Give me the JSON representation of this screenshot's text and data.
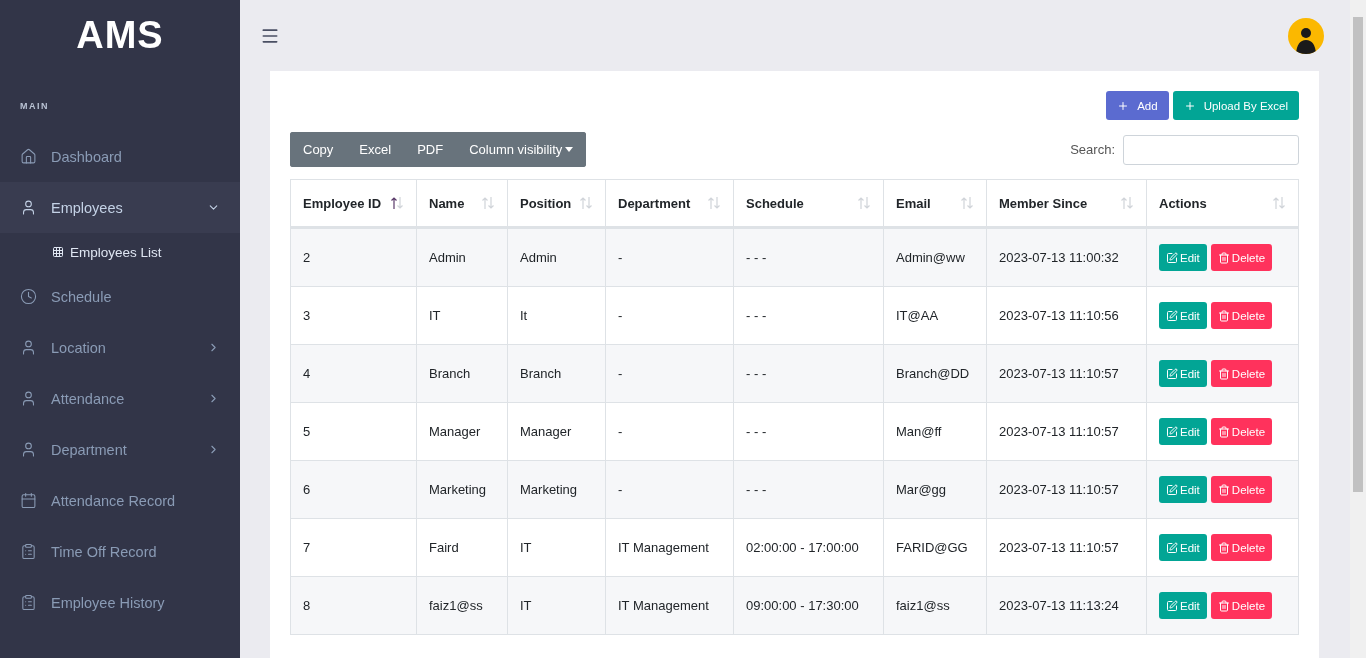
{
  "brand": "AMS",
  "sidebar": {
    "section": "MAIN",
    "items": [
      {
        "label": "Dashboard",
        "kind": "link",
        "selected": false
      },
      {
        "label": "Employees",
        "kind": "group",
        "selected": true,
        "expanded": true,
        "children": [
          {
            "label": "Employees List"
          }
        ]
      },
      {
        "label": "Schedule",
        "kind": "link",
        "selected": false
      },
      {
        "label": "Location",
        "kind": "group",
        "selected": false,
        "expanded": false
      },
      {
        "label": "Attendance",
        "kind": "group",
        "selected": false,
        "expanded": false
      },
      {
        "label": "Department",
        "kind": "group",
        "selected": false,
        "expanded": false
      },
      {
        "label": "Attendance Record",
        "kind": "link",
        "selected": false
      },
      {
        "label": "Time Off Record",
        "kind": "link",
        "selected": false
      },
      {
        "label": "Employee History",
        "kind": "link",
        "selected": false
      }
    ]
  },
  "page_actions": [
    {
      "label": "Add",
      "kind": "primary"
    },
    {
      "label": "Upload By Excel",
      "kind": "success"
    }
  ],
  "export_buttons": [
    {
      "label": "Copy",
      "kind": "plain"
    },
    {
      "label": "Excel",
      "kind": "plain"
    },
    {
      "label": "PDF",
      "kind": "plain"
    },
    {
      "label": "Column visibility",
      "kind": "dropdown"
    }
  ],
  "search": {
    "label": "Search:"
  },
  "table": {
    "columns": [
      {
        "label": "Employee ID",
        "sorted_ascending": true
      },
      {
        "label": "Name",
        "sorted_ascending": false
      },
      {
        "label": "Position",
        "sorted_ascending": false
      },
      {
        "label": "Department",
        "sorted_ascending": false
      },
      {
        "label": "Schedule",
        "sorted_ascending": false
      },
      {
        "label": "Email",
        "sorted_ascending": false
      },
      {
        "label": "Member Since",
        "sorted_ascending": false
      },
      {
        "label": "Actions",
        "sorted_ascending": false
      }
    ],
    "rows": [
      {
        "cells": [
          "2",
          "Admin",
          "Admin",
          "-",
          "- - -",
          "Admin@ww",
          "2023-07-13 11:00:32"
        ],
        "actions": [
          "Edit",
          "Delete"
        ]
      },
      {
        "cells": [
          "3",
          "IT",
          "It",
          "-",
          "- - -",
          "IT@AA",
          "2023-07-13 11:10:56"
        ],
        "actions": [
          "Edit",
          "Delete"
        ]
      },
      {
        "cells": [
          "4",
          "Branch",
          "Branch",
          "-",
          "- - -",
          "Branch@DD",
          "2023-07-13 11:10:57"
        ],
        "actions": [
          "Edit",
          "Delete"
        ]
      },
      {
        "cells": [
          "5",
          "Manager",
          "Manager",
          "-",
          "- - -",
          "Man@ff",
          "2023-07-13 11:10:57"
        ],
        "actions": [
          "Edit",
          "Delete"
        ]
      },
      {
        "cells": [
          "6",
          "Marketing",
          "Marketing",
          "-",
          "- - -",
          "Mar@gg",
          "2023-07-13 11:10:57"
        ],
        "actions": [
          "Edit",
          "Delete"
        ]
      },
      {
        "cells": [
          "7",
          "Faird",
          "IT",
          "IT Management",
          "02:00:00 - 17:00:00",
          "FARID@GG",
          "2023-07-13 11:10:57"
        ],
        "actions": [
          "Edit",
          "Delete"
        ]
      },
      {
        "cells": [
          "8",
          "faiz1@ss",
          "IT",
          "IT Management",
          "09:00:00 - 17:30:00",
          "faiz1@ss",
          "2023-07-13 11:13:24"
        ],
        "actions": [
          "Edit",
          "Delete"
        ]
      }
    ]
  }
}
